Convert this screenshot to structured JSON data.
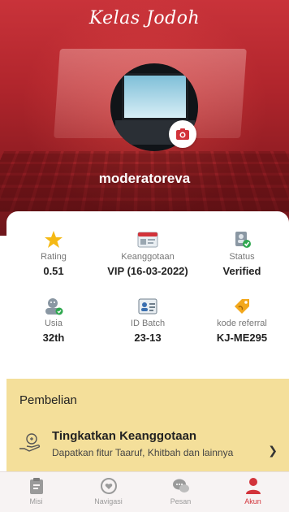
{
  "header": {
    "app_title": "Kelas Jodoh",
    "username": "moderatoreva"
  },
  "stats": [
    {
      "label": "Rating",
      "value": "0.51",
      "icon": "star-icon"
    },
    {
      "label": "Keanggotaan",
      "value": "VIP (16-03-2022)",
      "icon": "membership-card-icon"
    },
    {
      "label": "Status",
      "value": "Verified",
      "icon": "verified-user-icon"
    },
    {
      "label": "Usia",
      "value": "32th",
      "icon": "age-user-icon"
    },
    {
      "label": "ID Batch",
      "value": "23-13",
      "icon": "id-card-icon"
    },
    {
      "label": "kode referral",
      "value": "KJ-ME295",
      "icon": "referral-tag-icon"
    }
  ],
  "purchase": {
    "section_title": "Pembelian",
    "upgrade_title": "Tingkatkan Keanggotaan",
    "upgrade_desc": "Dapatkan fitur Taaruf, Khitbah dan lainnya"
  },
  "nav": [
    {
      "label": "Misi",
      "icon": "clipboard-icon"
    },
    {
      "label": "Navigasi",
      "icon": "heart-compass-icon"
    },
    {
      "label": "Pesan",
      "icon": "chat-icon"
    },
    {
      "label": "Akun",
      "icon": "user-icon",
      "active": true
    }
  ],
  "colors": {
    "brand_red": "#c9333a",
    "section_yellow": "#f4df9a",
    "star_yellow": "#f5b914"
  }
}
